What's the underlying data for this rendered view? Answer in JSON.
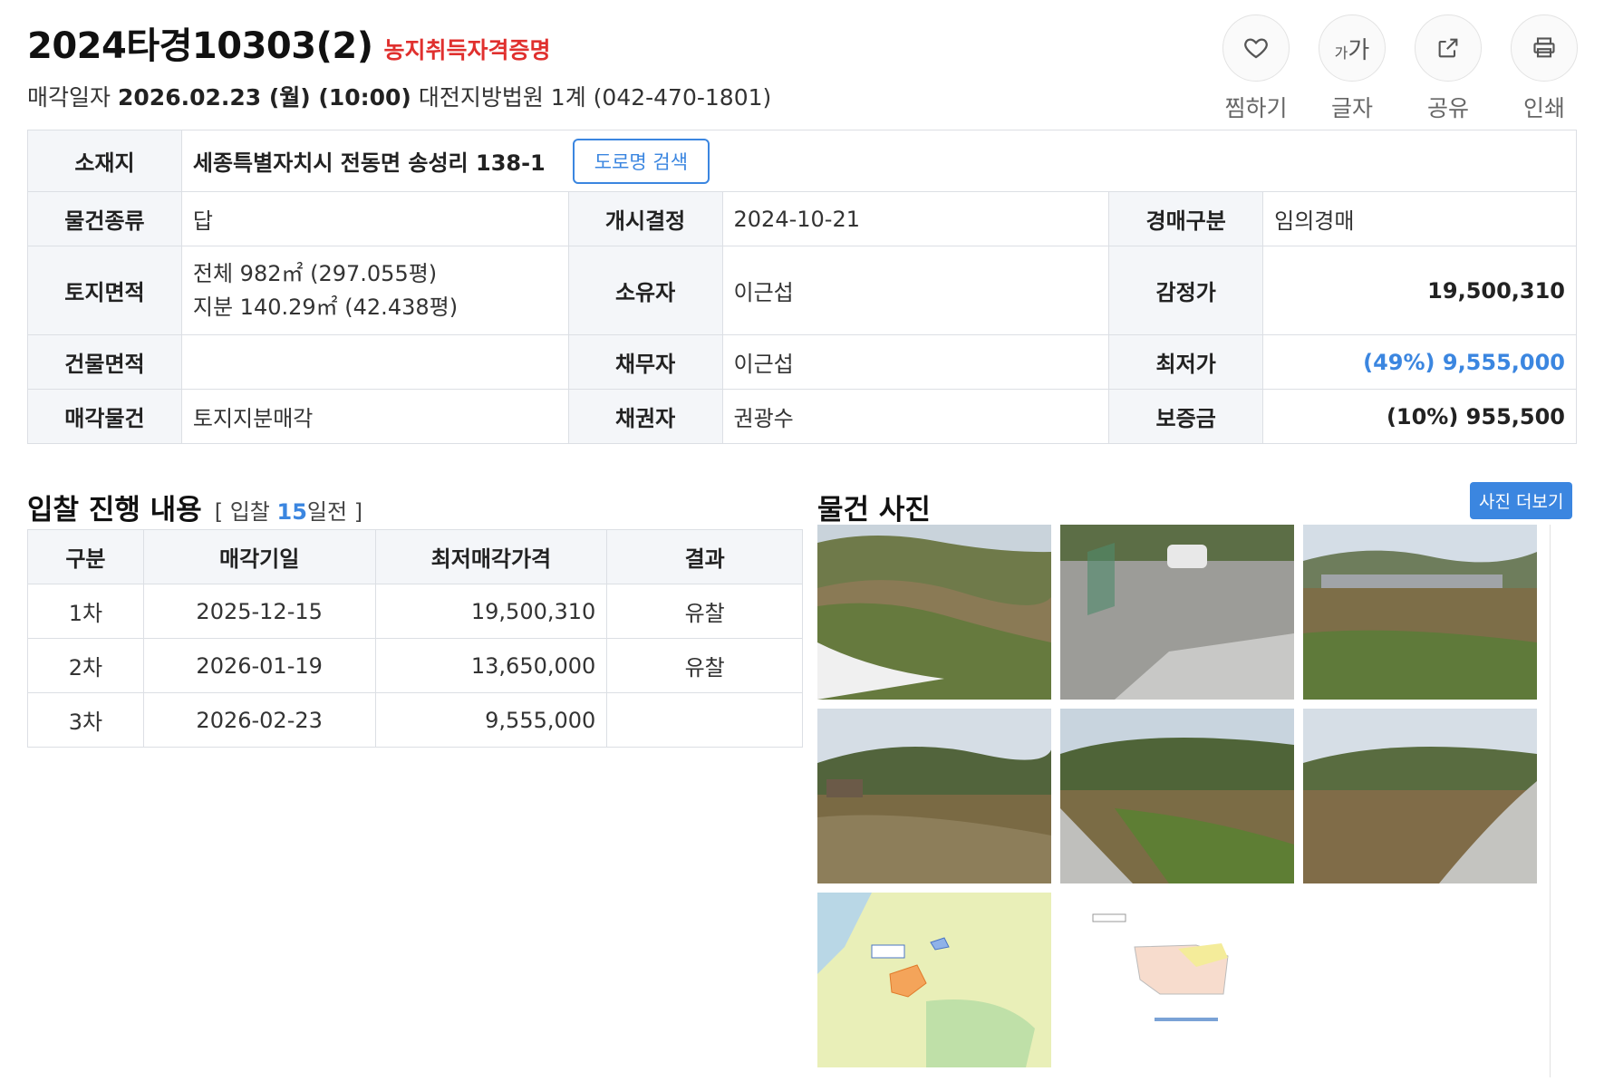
{
  "header": {
    "case_number": "2024타경10303(2)",
    "tag": "농지취득자격증명",
    "sale_label": "매각일자",
    "sale_datetime": "2026.02.23 (월) (10:00)",
    "court": "대전지방법원 1계 (042-470-1801)"
  },
  "actions": [
    {
      "label": "찜하기",
      "icon": "heart-icon"
    },
    {
      "label": "글자",
      "icon": "font-size-icon",
      "glyph_small": "가",
      "glyph_big": "가"
    },
    {
      "label": "공유",
      "icon": "share-icon"
    },
    {
      "label": "인쇄",
      "icon": "print-icon"
    }
  ],
  "info": {
    "location_label": "소재지",
    "location_value": "세종특별자치시 전동면 송성리 138-1",
    "road_search_label": "도로명 검색",
    "type_label": "물건종류",
    "type_value": "답",
    "start_label": "개시결정",
    "start_value": "2024-10-21",
    "auction_type_label": "경매구분",
    "auction_type_value": "임의경매",
    "land_area_label": "토지면적",
    "land_area_line1": "전체 982㎡ (297.055평)",
    "land_area_line2": "지분 140.29㎡ (42.438평)",
    "owner_label": "소유자",
    "owner_value": "이근섭",
    "appraisal_label": "감정가",
    "appraisal_value": "19,500,310",
    "building_area_label": "건물면적",
    "building_area_value": "",
    "debtor_label": "채무자",
    "debtor_value": "이근섭",
    "min_price_label": "최저가",
    "min_price_value": "(49%) 9,555,000",
    "sale_item_label": "매각물건",
    "sale_item_value": "토지지분매각",
    "creditor_label": "채권자",
    "creditor_value": "권광수",
    "deposit_label": "보증금",
    "deposit_value": "(10%) 955,500"
  },
  "bid": {
    "title": "입찰 진행 내용",
    "sub_prefix": "[ 입찰",
    "days": "15",
    "sub_suffix": "일전 ]",
    "columns": [
      "구분",
      "매각기일",
      "최저매각가격",
      "결과"
    ],
    "rows": [
      {
        "round": "1차",
        "date": "2025-12-15",
        "price": "19,500,310",
        "result": "유찰"
      },
      {
        "round": "2차",
        "date": "2026-01-19",
        "price": "13,650,000",
        "result": "유찰"
      },
      {
        "round": "3차",
        "date": "2026-02-23",
        "price": "9,555,000",
        "result": ""
      }
    ]
  },
  "photos": {
    "title": "물건 사진",
    "more_label": "사진 더보기"
  }
}
